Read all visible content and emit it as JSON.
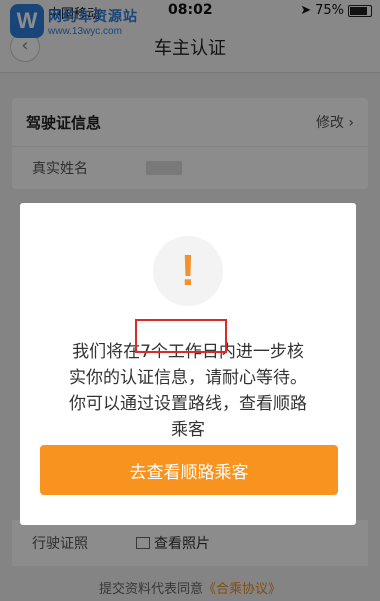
{
  "status_bar": {
    "carrier": "中国移动",
    "time": "08:02",
    "battery": "75%"
  },
  "watermark": {
    "badge": "W",
    "title": "网约车资源站",
    "url": "www.13wyc.com"
  },
  "nav": {
    "title": "车主认证"
  },
  "license_card": {
    "title": "驾驶证信息",
    "edit_label": "修改",
    "real_name_label": "真实姓名"
  },
  "vehicle_row": {
    "label": "行驶证照",
    "view_photo_label": "查看照片"
  },
  "footer": {
    "prefix": "提交资料代表同意",
    "agreement_link": "《合乘协议》"
  },
  "dialog": {
    "message_lines": [
      "我们将在7个工作日内进一步核",
      "实你的认证信息，请耐心等待。",
      "你可以通过设置路线，查看顺路",
      "乘客"
    ],
    "cta_label": "去查看顺路乘客"
  },
  "colors": {
    "accent": "#f7931e",
    "highlight_border": "#d92b2b",
    "brand_blue": "#2f7fe0"
  }
}
